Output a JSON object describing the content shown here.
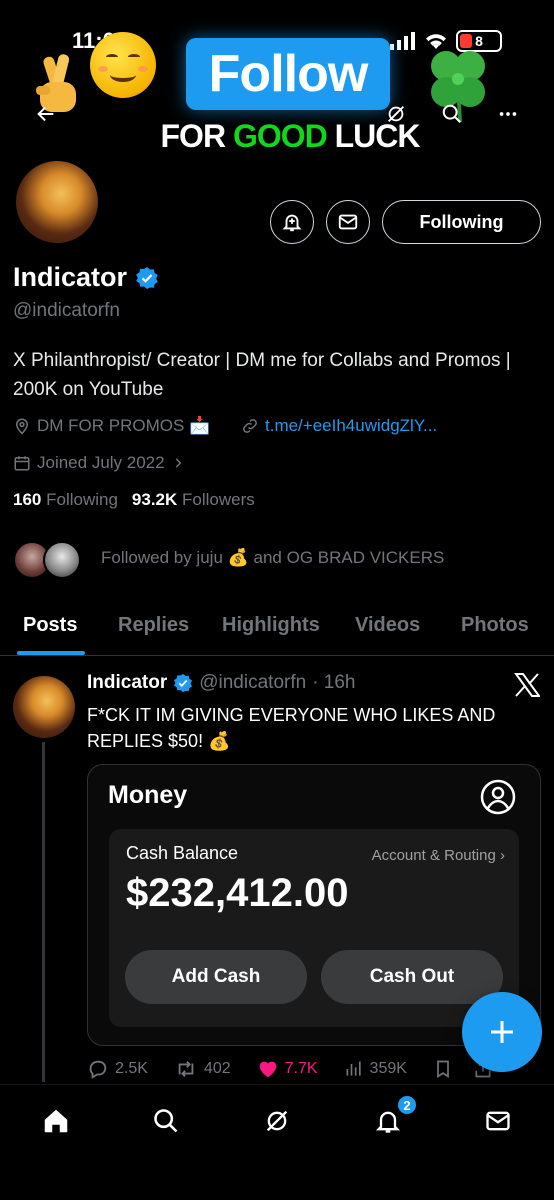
{
  "status_bar": {
    "time": "11:06",
    "battery": "8"
  },
  "overlay": {
    "follow_label": "Follow",
    "luck_pre": "FOR ",
    "luck_good": "GOOD",
    "luck_post": " LUCK"
  },
  "profile": {
    "name": "Indicator",
    "handle": "@indicatorfn",
    "bio": "X Philanthropist/ Creator | DM me for Collabs and Promos | 200K on YouTube",
    "location": "DM FOR PROMOS 📩",
    "link": "t.me/+eeIh4uwidgZlY...",
    "joined": "Joined July 2022",
    "following_count": "160",
    "following_label": "Following",
    "followers_count": "93.2K",
    "followers_label": "Followers",
    "followed_by": "Followed by juju 💰 and OG BRAD VICKERS",
    "follow_state_label": "Following"
  },
  "tabs": [
    "Posts",
    "Replies",
    "Highlights",
    "Videos",
    "Photos"
  ],
  "tweet": {
    "name": "Indicator",
    "handle": "@indicatorfn",
    "time": "· 16h",
    "text": "F*CK IT IM GIVING EVERYONE WHO LIKES AND REPLIES $50! 💰",
    "media": {
      "title": "Money",
      "cash_label": "Cash Balance",
      "account_label": "Account & Routing",
      "amount": "$232,412.00",
      "add_cash": "Add Cash",
      "cash_out": "Cash Out"
    },
    "replies": "2.5K",
    "reposts": "402",
    "likes": "7.7K",
    "views": "359K"
  },
  "nav": {
    "notifications_badge": "2"
  },
  "colors": {
    "accent": "#1d9bf0",
    "like": "#f91880",
    "background": "#000000"
  }
}
